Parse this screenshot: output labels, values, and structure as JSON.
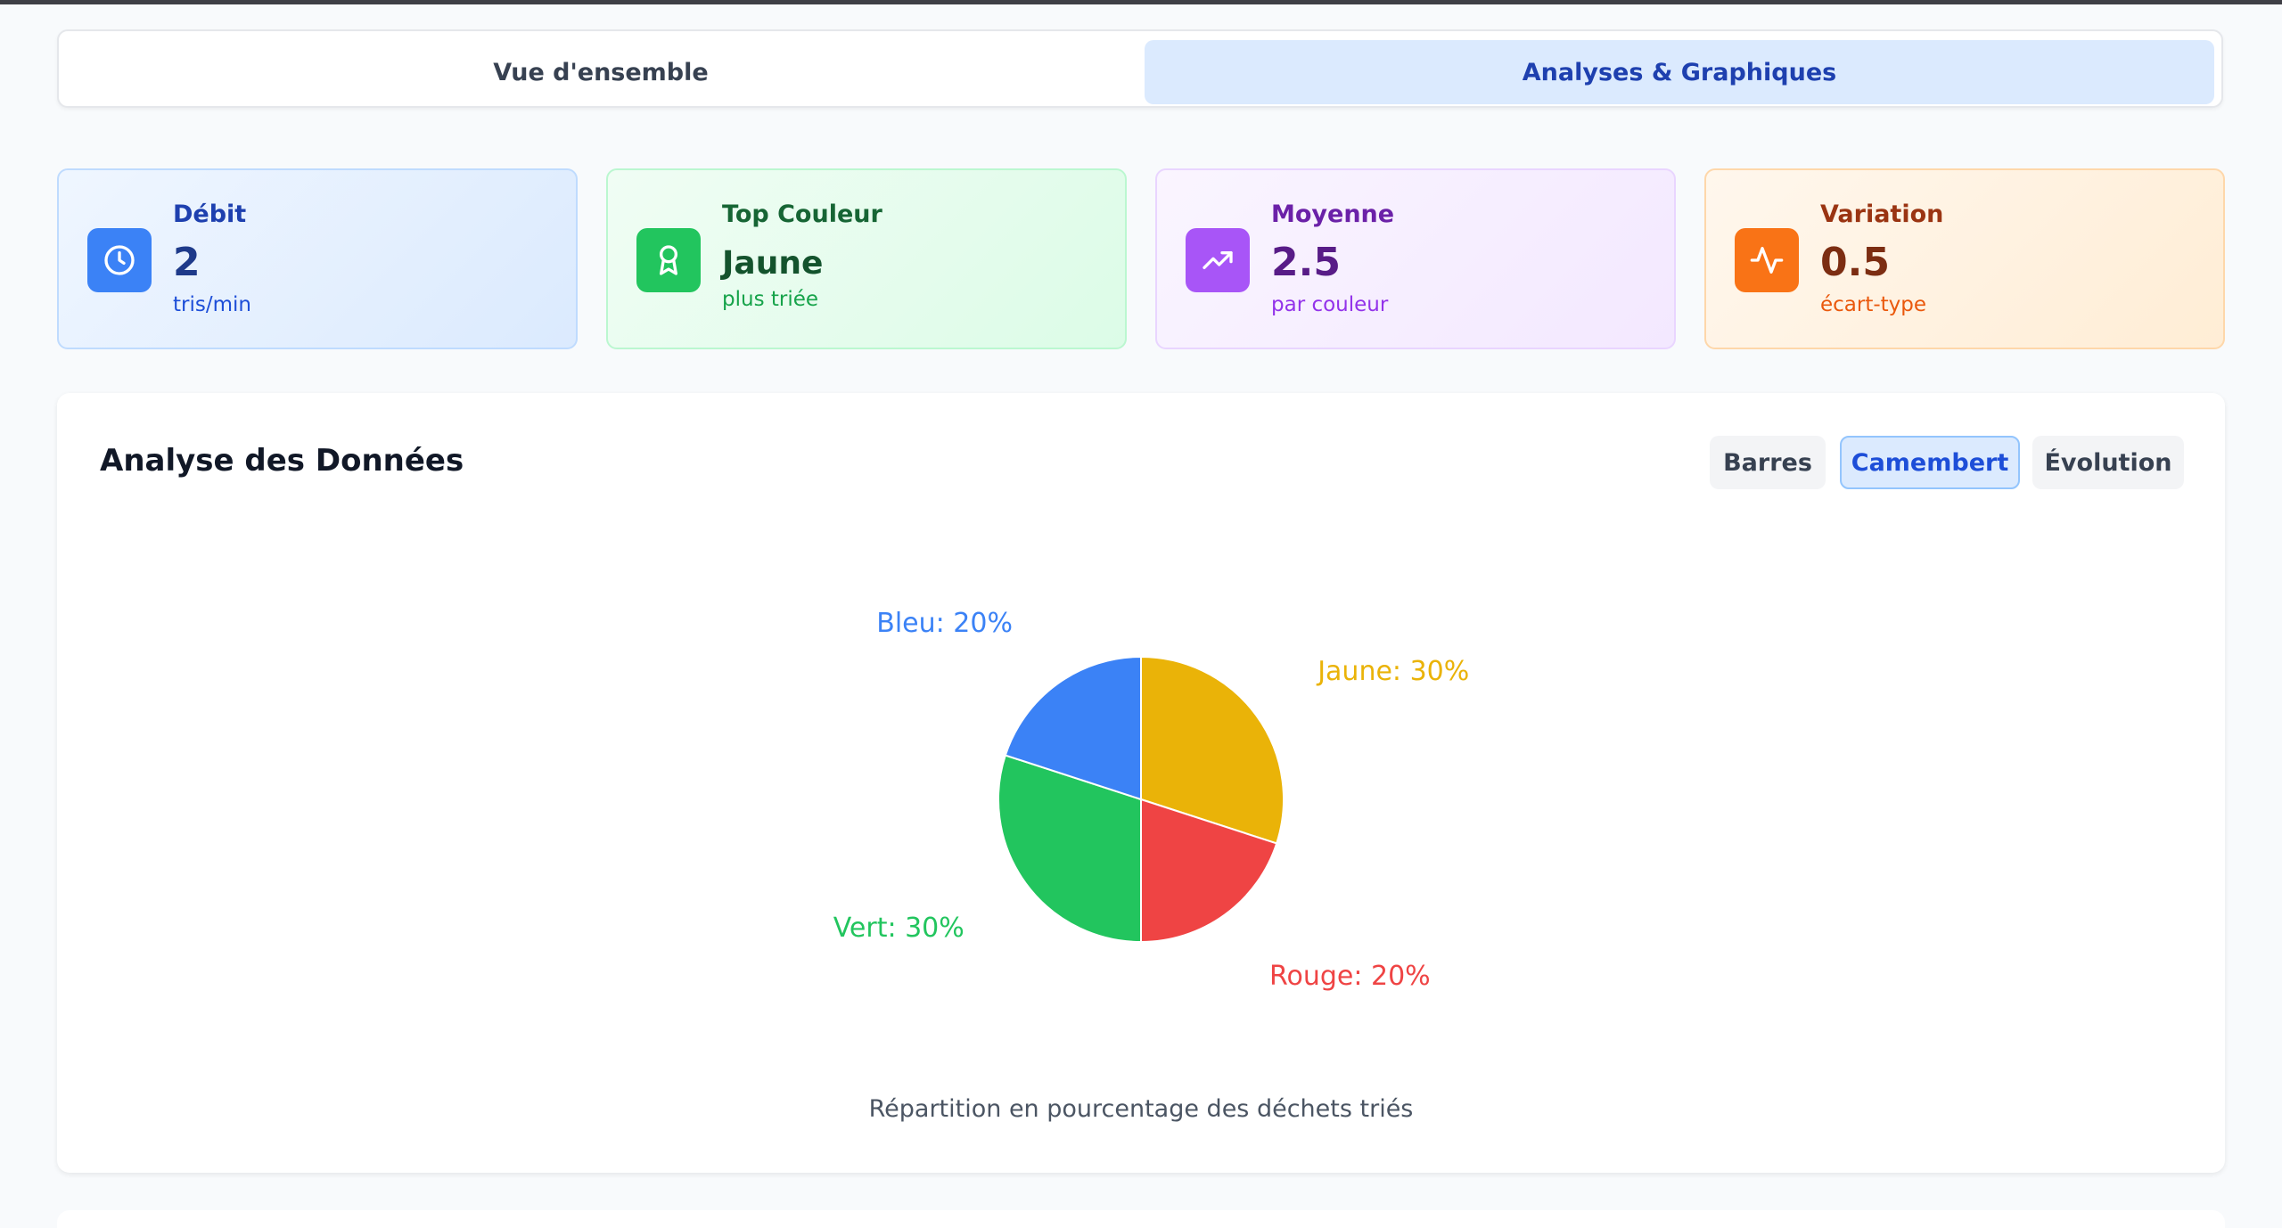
{
  "tabs": [
    {
      "label": "Vue d'ensemble",
      "active": false
    },
    {
      "label": "Analyses & Graphiques",
      "active": true
    }
  ],
  "stats": [
    {
      "label": "Débit",
      "value": "2",
      "sub": "tris/min",
      "icon": "clock-icon"
    },
    {
      "label": "Top Couleur",
      "value": "Jaune",
      "sub": "plus triée",
      "icon": "award-icon"
    },
    {
      "label": "Moyenne",
      "value": "2.5",
      "sub": "par couleur",
      "icon": "trending-up-icon"
    },
    {
      "label": "Variation",
      "value": "0.5",
      "sub": "écart-type",
      "icon": "activity-icon"
    }
  ],
  "panel": {
    "title": "Analyse des Données",
    "chart_types": [
      {
        "label": "Barres",
        "active": false
      },
      {
        "label": "Camembert",
        "active": true
      },
      {
        "label": "Évolution",
        "active": false
      }
    ],
    "caption": "Répartition en pourcentage des déchets triés"
  },
  "colors": {
    "Jaune": "#eab308",
    "Rouge": "#ef4444",
    "Vert": "#22c55e",
    "Bleu": "#3b82f6"
  },
  "chart_data": {
    "type": "pie",
    "categories": [
      "Jaune",
      "Rouge",
      "Vert",
      "Bleu"
    ],
    "values": [
      30,
      20,
      30,
      20
    ],
    "labels": [
      "Jaune: 30%",
      "Rouge: 20%",
      "Vert: 30%",
      "Bleu: 20%"
    ],
    "colors": [
      "#eab308",
      "#ef4444",
      "#22c55e",
      "#3b82f6"
    ]
  }
}
